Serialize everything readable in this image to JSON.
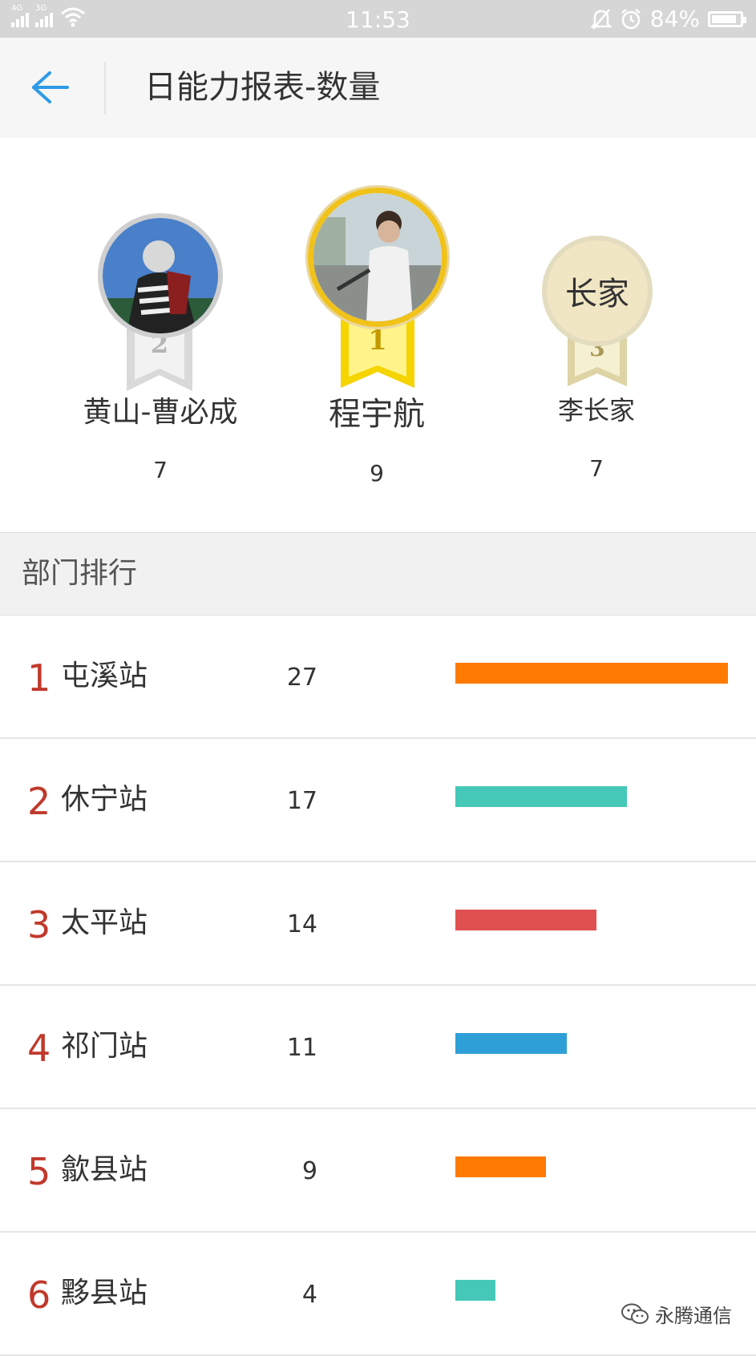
{
  "status_bar": {
    "net1": "4G",
    "net2": "3G",
    "time": "11:53",
    "battery": "84%"
  },
  "header": {
    "title": "日能力报表-数量"
  },
  "podium": [
    {
      "rank": "2",
      "name": "黄山-曹必成",
      "value": "7",
      "avatar_type": "image",
      "medal_color": "silver"
    },
    {
      "rank": "1",
      "name": "程宇航",
      "value": "9",
      "avatar_type": "image",
      "medal_color": "gold"
    },
    {
      "rank": "3",
      "name": "李长家",
      "value": "7",
      "avatar_type": "text",
      "avatar_text": "长家",
      "medal_color": "bronze"
    }
  ],
  "section": {
    "title": "部门排行"
  },
  "departments": [
    {
      "rank": "1",
      "name": "屯溪站",
      "value": 27,
      "color": "#ff7a00"
    },
    {
      "rank": "2",
      "name": "休宁站",
      "value": 17,
      "color": "#45c8b8"
    },
    {
      "rank": "3",
      "name": "太平站",
      "value": 14,
      "color": "#e05050"
    },
    {
      "rank": "4",
      "name": "祁门站",
      "value": 11,
      "color": "#2f9fd8"
    },
    {
      "rank": "5",
      "name": "歙县站",
      "value": 9,
      "color": "#ff7a00"
    },
    {
      "rank": "6",
      "name": "黟县站",
      "value": 4,
      "color": "#45c8b8"
    }
  ],
  "watermark": {
    "text": "永腾通信",
    "icon": "wechat-icon"
  },
  "colors": {
    "accent": "#2e9be6",
    "rank_red": "#c0392b",
    "gold": "#f2c200",
    "silver": "#c9c9c9",
    "bronze": "#e8dcb0"
  }
}
